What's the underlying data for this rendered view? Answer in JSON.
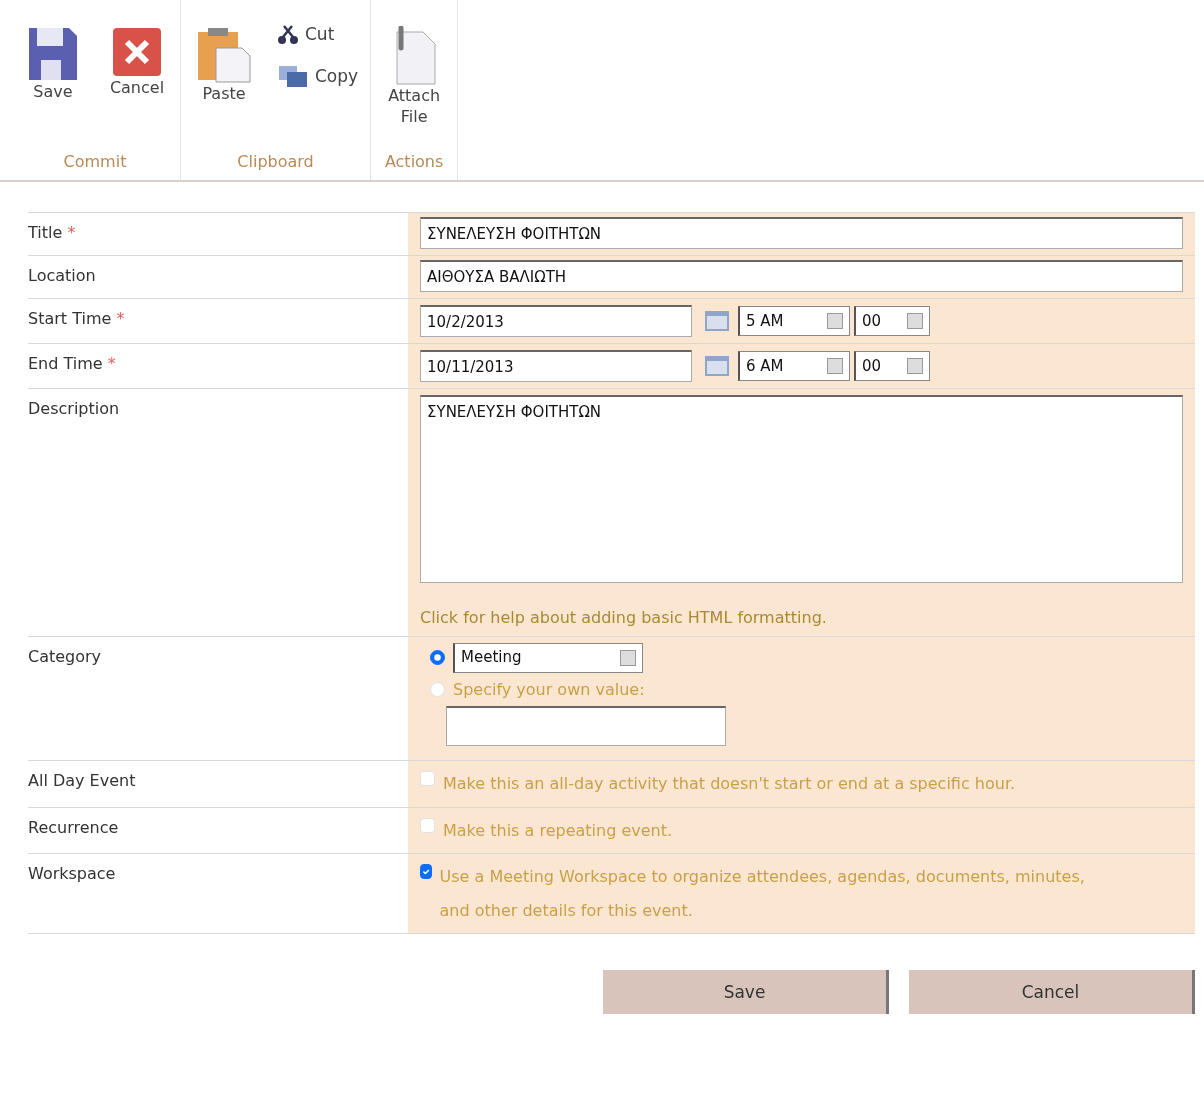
{
  "ribbon": {
    "groups": [
      {
        "label": "Commit",
        "buttons": [
          {
            "label": "Save",
            "kind": "large"
          },
          {
            "label": "Cancel",
            "kind": "large"
          }
        ]
      },
      {
        "label": "Clipboard",
        "buttons": [
          {
            "label": "Paste",
            "kind": "large"
          },
          {
            "label": "Cut",
            "kind": "small"
          },
          {
            "label": "Copy",
            "kind": "small"
          }
        ]
      },
      {
        "label": "Actions",
        "buttons": [
          {
            "label": "Attach File",
            "kind": "large"
          }
        ]
      }
    ]
  },
  "fields": [
    {
      "kind": "text",
      "label": "Title",
      "required_mark": "*",
      "value": "ΣΥΝΕΛΕΥΣΗ ΦΟΙΤΗΤΩΝ"
    },
    {
      "kind": "text",
      "label": "Location",
      "value": "ΑΙΘΟΥΣΑ ΒΑΛΙΩΤΗ"
    },
    {
      "kind": "datetime",
      "label": "Start Time",
      "required_mark": "*",
      "date": "10/2/2013",
      "hour": "5 AM",
      "minute": "00"
    },
    {
      "kind": "datetime",
      "label": "End Time",
      "required_mark": "*",
      "date": "10/11/2013",
      "hour": "6 AM",
      "minute": "00"
    },
    {
      "kind": "textarea",
      "label": "Description",
      "value": "ΣΥΝΕΛΕΥΣΗ ΦΟΙΤΗΤΩΝ",
      "help": "Click for help about adding basic HTML formatting."
    },
    {
      "kind": "choice",
      "label": "Category",
      "options": [
        {
          "kind": "dropdown",
          "value": "Meeting",
          "selected": true
        },
        {
          "kind": "custom",
          "label": "Specify your own value:",
          "selected": false
        }
      ]
    },
    {
      "kind": "checkbox",
      "label": "All Day Event",
      "checked": false,
      "text": "Make this an all-day activity that doesn't start or end at a specific hour."
    },
    {
      "kind": "checkbox",
      "label": "Recurrence",
      "checked": false,
      "text": "Make this a repeating event."
    },
    {
      "kind": "checkbox",
      "label": "Workspace",
      "checked": true,
      "text": "Use a Meeting Workspace to organize attendees, agendas, documents, minutes, and other details for this event."
    }
  ],
  "buttons": [
    "Save",
    "Cancel"
  ]
}
